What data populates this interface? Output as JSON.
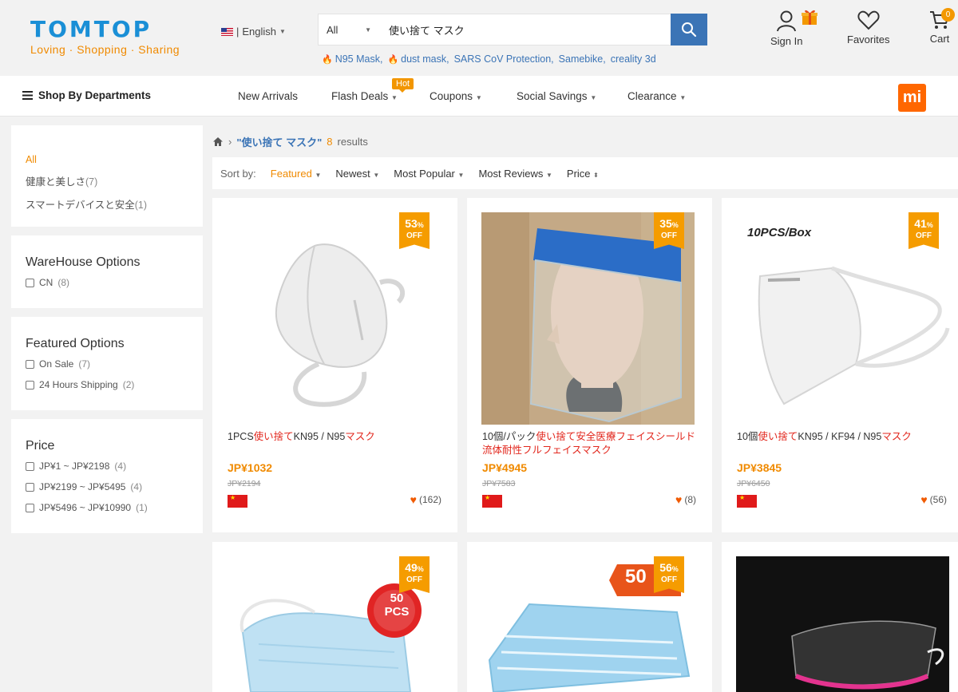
{
  "header": {
    "logo_name": "TOMTOP",
    "logo_tagline": "Loving · Shopping · Sharing",
    "language": "English",
    "search": {
      "category": "All",
      "query": "使い捨て マスク"
    },
    "hot_terms": [
      "N95 Mask,",
      "dust mask,",
      "SARS CoV Protection,",
      "Samebike,",
      "creality 3d"
    ],
    "sign_in": "Sign In",
    "favorites": "Favorites",
    "cart": "Cart",
    "cart_count": "0"
  },
  "nav": {
    "departments": "Shop By Departments",
    "items": [
      "New Arrivals",
      "Flash Deals",
      "Coupons",
      "Social Savings",
      "Clearance"
    ],
    "hot_label": "Hot",
    "brand_logo": "mi"
  },
  "sidebar": {
    "categories": [
      {
        "label": "All",
        "count": ""
      },
      {
        "label": "健康と美しさ",
        "count": "(7)"
      },
      {
        "label": "スマートデバイスと安全",
        "count": "(1)"
      }
    ],
    "warehouse": {
      "title": "WareHouse Options",
      "options": [
        {
          "label": "CN",
          "count": "(8)"
        }
      ]
    },
    "featured": {
      "title": "Featured Options",
      "options": [
        {
          "label": "On Sale",
          "count": "(7)"
        },
        {
          "label": "24 Hours Shipping",
          "count": "(2)"
        }
      ]
    },
    "price": {
      "title": "Price",
      "options": [
        {
          "label": "JP¥1 ~ JP¥2198",
          "count": "(4)"
        },
        {
          "label": "JP¥2199 ~ JP¥5495",
          "count": "(4)"
        },
        {
          "label": "JP¥5496 ~ JP¥10990",
          "count": "(1)"
        }
      ]
    }
  },
  "results": {
    "query_label": "\"使い捨て マスク\"",
    "count": "8",
    "count_suffix": "results",
    "sort_label": "Sort by:",
    "sort_options": [
      "Featured",
      "Newest",
      "Most Popular",
      "Most Reviews",
      "Price"
    ],
    "active_sort": "Featured"
  },
  "products": [
    {
      "discount": "53",
      "title_parts": [
        "1PCS",
        "使い捨て",
        "KN95 / N95",
        "マスク"
      ],
      "price": "JP¥1032",
      "old_price": "JP¥2194",
      "likes": "(162)"
    },
    {
      "discount": "35",
      "title_parts": [
        "10個/パック",
        "使い捨て",
        "安全医療フェイスシールド流体耐性フルフェイスマスク",
        ""
      ],
      "price": "JP¥4945",
      "old_price": "JP¥7583",
      "likes": "(8)"
    },
    {
      "discount": "41",
      "title_parts": [
        "10個",
        "使い捨て",
        "KN95 / KF94 / N95",
        "マスク"
      ],
      "price": "JP¥3845",
      "old_price": "JP¥6450",
      "likes": "(56)",
      "image_text": "10PCS/Box"
    },
    {
      "discount": "49",
      "image_text": "50 PCS"
    },
    {
      "discount": "56",
      "image_text": "50"
    },
    {}
  ],
  "colors": {
    "brand_blue": "#1a8fd6",
    "accent_orange": "#f08a00",
    "keyword_red": "#e2261c",
    "search_button": "#3b74b6"
  },
  "percent_sign": "%",
  "off_label": "OFF"
}
